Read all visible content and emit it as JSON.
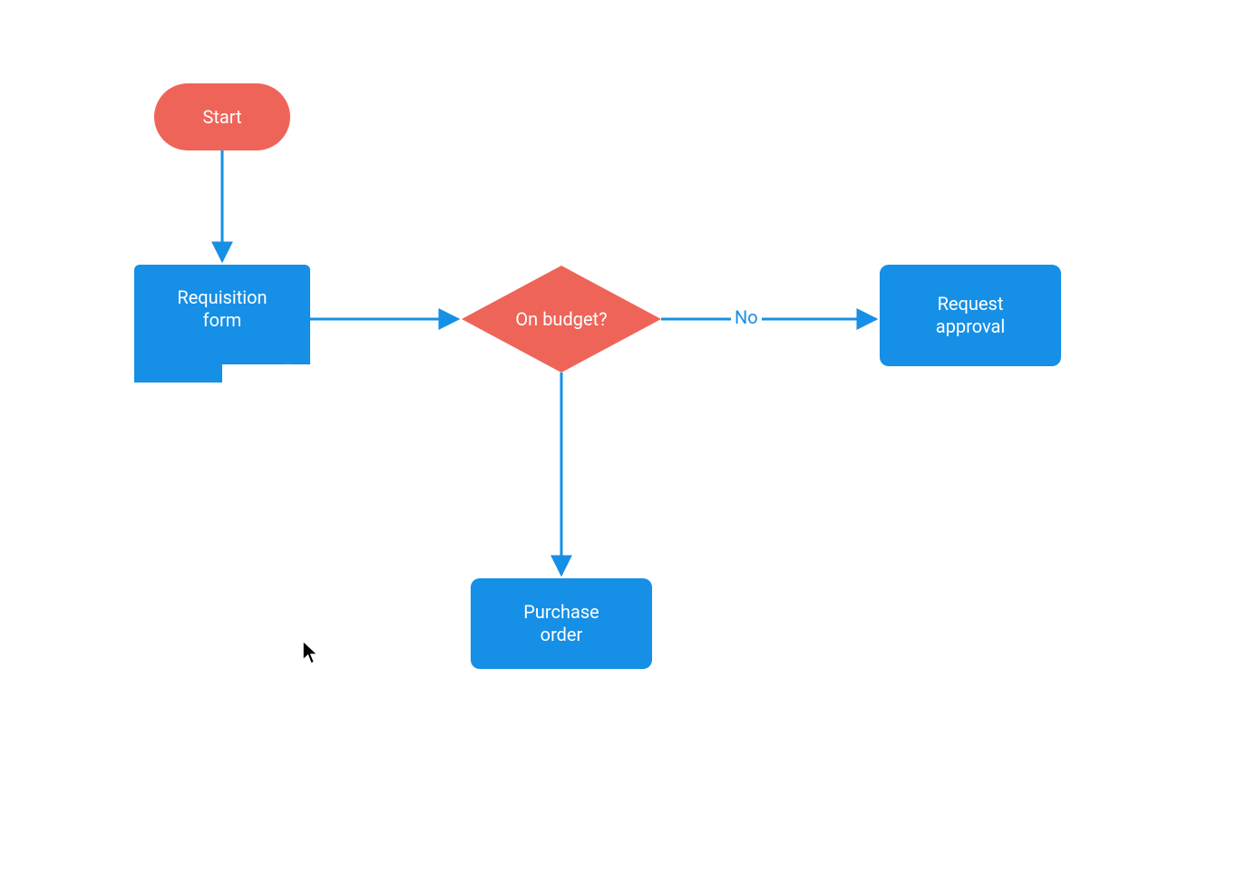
{
  "colors": {
    "blue": "#168fe6",
    "red": "#ef6459"
  },
  "nodes": {
    "start": {
      "label": "Start"
    },
    "requisition": {
      "label_line1": "Requisition",
      "label_line2": "form"
    },
    "decision": {
      "label": "On budget?"
    },
    "purchase": {
      "label_line1": "Purchase",
      "label_line2": "order"
    },
    "request": {
      "label_line1": "Request",
      "label_line2": "approval"
    }
  },
  "edges": {
    "no": {
      "label": "No"
    }
  }
}
